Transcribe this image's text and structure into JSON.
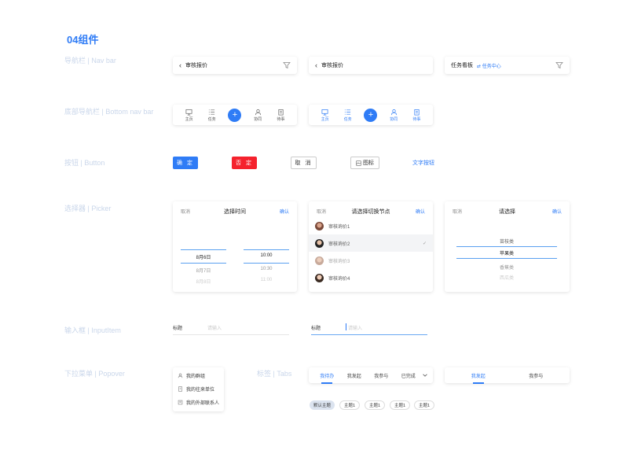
{
  "page_title": "04组件",
  "labels": {
    "navbar": "导航栏 | Nav bar",
    "bottom_nav": "底部导航栏 | Bottom nav bar",
    "button": "按钮 | Button",
    "picker": "选择器 | Picker",
    "input": "输入框 | InputItem",
    "popover": "下拉菜单 | Popover",
    "tabs": "标签 | Tabs"
  },
  "navbars": [
    {
      "title": "审核报价"
    },
    {
      "title": "审核报价"
    },
    {
      "title": "任务看板",
      "sub": "⇄ 任务中心"
    }
  ],
  "bottom_nav": {
    "items": [
      "主页",
      "任务",
      "协同",
      "待事"
    ]
  },
  "buttons": {
    "confirm": "确 定",
    "deny": "否 定",
    "cancel": "取 消",
    "icon": "图标",
    "text": "文字按钮"
  },
  "pickers": {
    "time": {
      "cancel": "取消",
      "title": "选择时间",
      "ok": "确认",
      "dates": [
        "8月6日",
        "8月7日",
        "8月8日"
      ],
      "times": [
        "10:00",
        "10:30",
        "11:00"
      ]
    },
    "node": {
      "cancel": "取消",
      "title": "请选择切换节点",
      "ok": "确认",
      "items": [
        "审核询价1",
        "审核询价2",
        "审核询价3",
        "审核询价4"
      ],
      "check": "✓"
    },
    "list": {
      "cancel": "取消",
      "title": "请选择",
      "ok": "确认",
      "items": [
        "苗枝类",
        "苹果类",
        "香蕉类",
        "西瓜类"
      ]
    }
  },
  "inputs": [
    {
      "label": "标题",
      "placeholder": "请输入"
    },
    {
      "label": "标题",
      "placeholder": "请输入"
    }
  ],
  "popover": {
    "items": [
      "我的群组",
      "我的往来单位",
      "我的外部联系人"
    ]
  },
  "tabs": {
    "tabs1": [
      "我待办",
      "我发起",
      "我参与",
      "已完成"
    ],
    "tabs2": [
      "我发起",
      "我参与"
    ],
    "chips": [
      "默认主题",
      "主题1",
      "主题1",
      "主题1",
      "主题1"
    ]
  },
  "colors": {
    "primary": "#2f7cf6",
    "danger": "#f5222d",
    "label": "#c9d6ea"
  }
}
